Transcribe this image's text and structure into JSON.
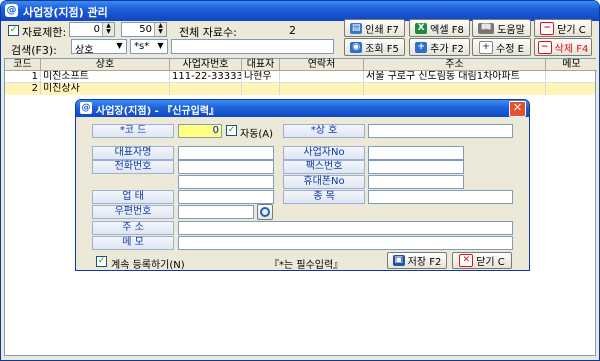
{
  "window": {
    "title": "사업장(지점) 관리"
  },
  "filter": {
    "limit_label": "자료제한:",
    "limit_from": "0",
    "limit_to": "50",
    "total_label": "전체 자료수:",
    "total_value": "2",
    "search_label": "검색(F3):",
    "search_field": "상호",
    "search_mode": "*s*",
    "search_value": ""
  },
  "toolbar": {
    "print": "인쇄 F7",
    "excel": "엑셀 F8",
    "help": "도움말",
    "close": "닫기 C",
    "query": "조회 F5",
    "add": "추가 F2",
    "edit": "수정 E",
    "delete": "삭제 F4"
  },
  "grid": {
    "columns": [
      "코드",
      "상호",
      "사업자번호",
      "대표자",
      "연락처",
      "주소",
      "메모"
    ],
    "rows": [
      {
        "code": "1",
        "name": "미진소프트",
        "biz_no": "111-22-33333",
        "rep": "나현우",
        "phone": "",
        "address": "서울 구로구 신도림동 대림1차아파트",
        "memo": ""
      },
      {
        "code": "2",
        "name": "미진상사",
        "biz_no": "",
        "rep": "",
        "phone": "",
        "address": "",
        "memo": ""
      }
    ]
  },
  "dialog": {
    "title": "사업장(지점) - 『신규입력』",
    "code_label": "*코    드",
    "code_value": "0",
    "auto_label": "자동(A)",
    "name_label": "*상    호",
    "rep_label": "대표자명",
    "biz_no_label": "사업자No",
    "phone_label": "전화번호",
    "fax_label": "팩스번호",
    "mobile_label": "휴대폰No",
    "business_type_label": "업    태",
    "item_label": "종    목",
    "zip_label": "우편번호",
    "address_label": "주    소",
    "memo_label": "메    모",
    "continue_label": "계속 등록하기(N)",
    "required_note": "『*는 필수입력』",
    "save": "저장 F2",
    "close": "닫기 C"
  }
}
